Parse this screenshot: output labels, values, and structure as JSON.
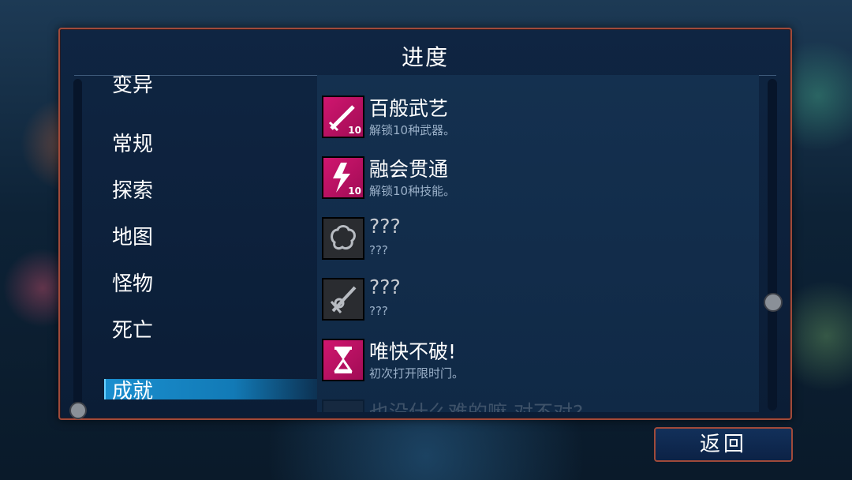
{
  "title": "进度",
  "categories": {
    "partial": "变异",
    "items": [
      "常规",
      "探索",
      "地图",
      "怪物",
      "死亡"
    ],
    "selected": "成就"
  },
  "achievements": [
    {
      "title": "百般武艺",
      "desc": "解锁10种武器。",
      "icon": "sword-icon",
      "badge": "10",
      "locked": false
    },
    {
      "title": "融会贯通",
      "desc": "解锁10种技能。",
      "icon": "lightning-icon",
      "badge": "10",
      "locked": false
    },
    {
      "title": "???",
      "desc": "???",
      "icon": "brain-icon",
      "locked": true
    },
    {
      "title": "???",
      "desc": "???",
      "icon": "dagger-icon",
      "locked": true
    },
    {
      "title": "唯快不破!",
      "desc": "初次打开限时门。",
      "icon": "hourglass-icon",
      "locked": false
    },
    {
      "title": "也没什么难的嘛,对不对?",
      "desc": "",
      "icon": "brain-icon",
      "locked": true
    }
  ],
  "back_label": "返回",
  "colors": {
    "panel_border": "#a04a3a",
    "accent_pink": "#d0166f",
    "selected_bar": "#1a8fcf"
  }
}
